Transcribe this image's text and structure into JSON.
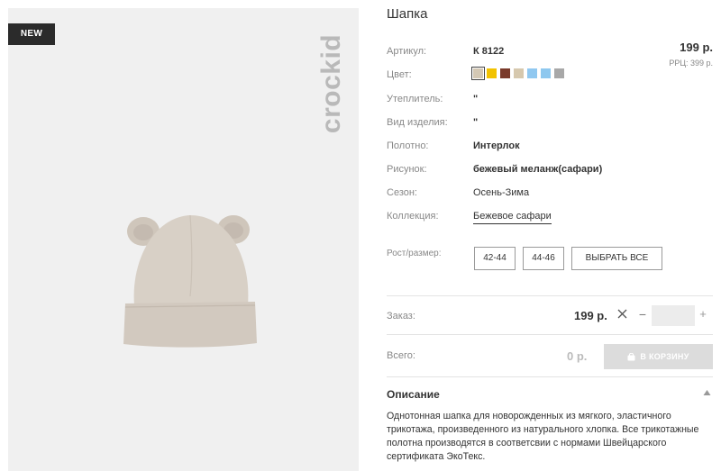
{
  "gallery": {
    "badge": "NEW",
    "brand": "crockid"
  },
  "product": {
    "title": "Шапка",
    "price": "199 р.",
    "rrp": "РРЦ: 399 р.",
    "attributes": [
      {
        "label": "Артикул:",
        "value": "К 8122"
      },
      {
        "label": "Цвет:"
      },
      {
        "label": "Утеплитель:",
        "value": "\""
      },
      {
        "label": "Вид изделия:",
        "value": "\""
      },
      {
        "label": "Полотно:",
        "value": "Интерлок"
      },
      {
        "label": "Рисунок:",
        "value": "бежевый меланж(сафари)"
      },
      {
        "label": "Сезон:",
        "value": "Осень-Зима"
      },
      {
        "label": "Коллекция:",
        "value": "Бежевое сафари"
      }
    ],
    "colors": [
      "#d4c8b4",
      "#f2c200",
      "#7a3a2a",
      "#d6c8ae",
      "#90c8f0",
      "#8ec8ef",
      "#a8a8a8"
    ],
    "selected_color_index": 0
  },
  "sizes": {
    "label": "Рост/размер:",
    "options": [
      "42-44",
      "44-46"
    ],
    "select_all": "ВЫБРАТЬ ВСЕ"
  },
  "order": {
    "label": "Заказ:",
    "price": "199 р.",
    "minus": "−",
    "plus": "+",
    "quantity": ""
  },
  "total": {
    "label": "Всего:",
    "value": "0 р.",
    "cart_button": "В КОРЗИНУ"
  },
  "description": {
    "title": "Описание",
    "text": "Однотонная шапка для новорожденных из мягкого, эластичного трикотажа, произведенного из натурального хлопка. Все трикотажные полотна производятся в соответсвии с нормами Швейцарского сертификата ЭкоТекс."
  },
  "icons": {
    "clear": "close-icon",
    "cart": "cart-icon",
    "collapse": "chevron-up-icon",
    "logo": "crockid-logo"
  }
}
